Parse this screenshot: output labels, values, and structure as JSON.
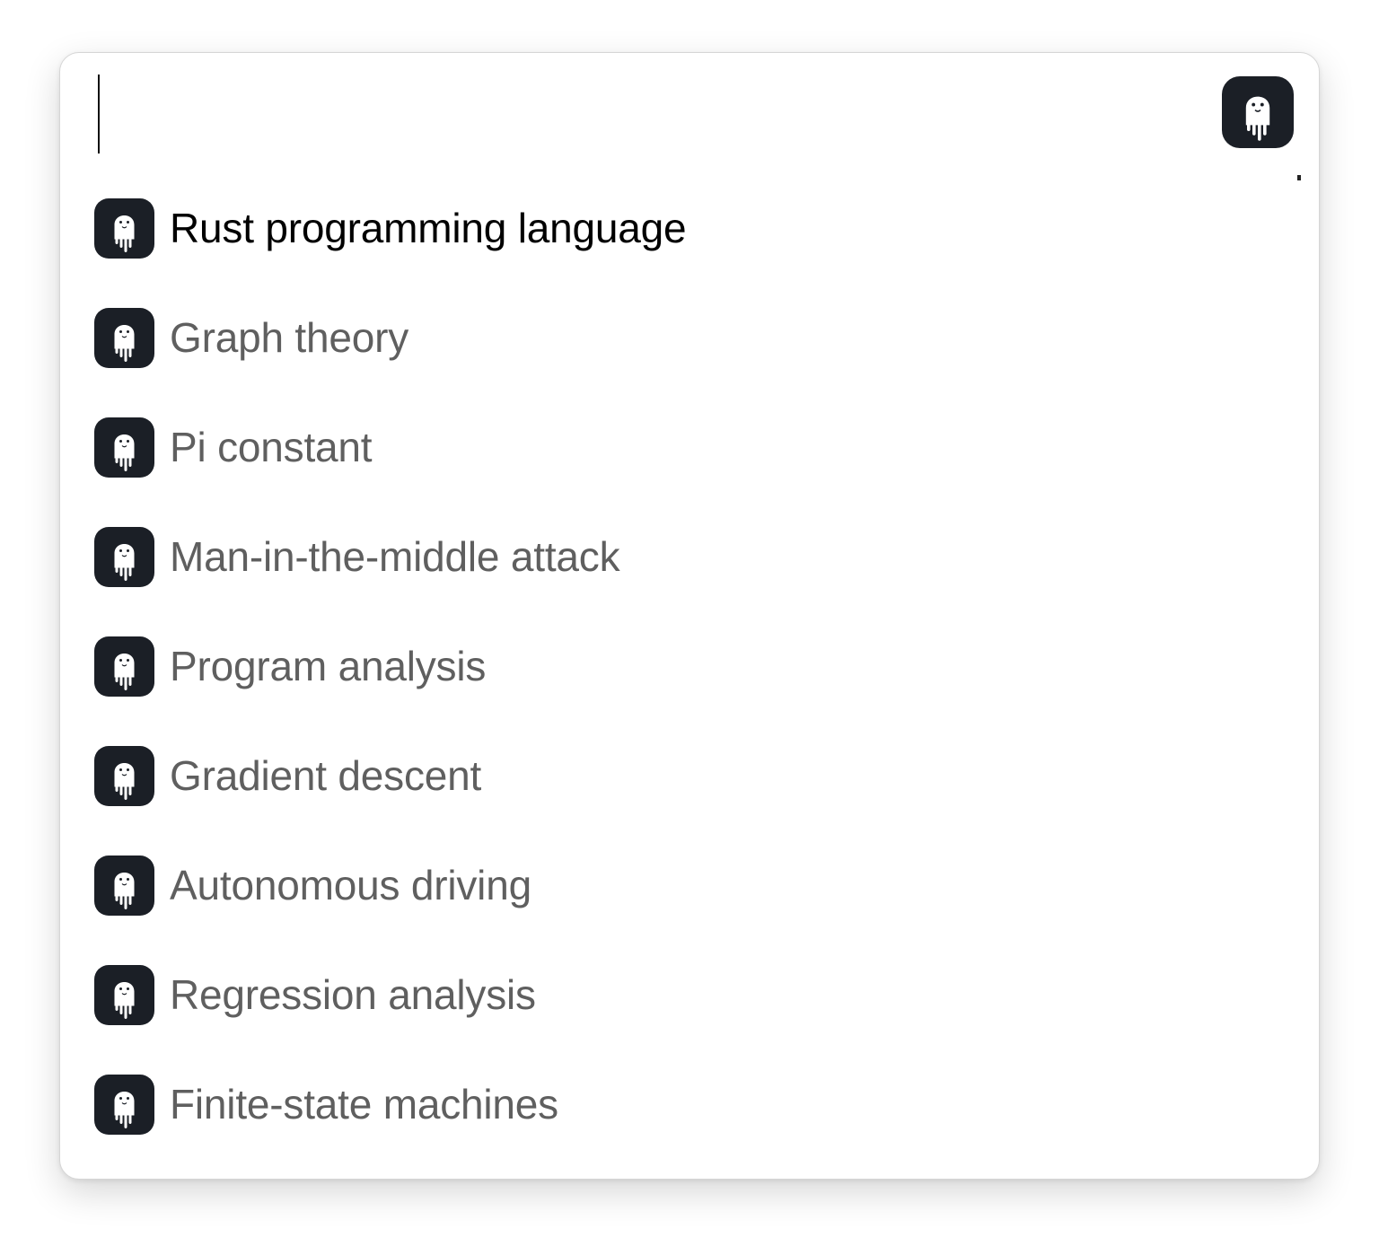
{
  "search": {
    "value": "",
    "placeholder": ""
  },
  "app": {
    "icon": "ghost-app-icon"
  },
  "colors": {
    "icon_bg": "#1b1f26",
    "icon_fg": "#ffffff",
    "selected_text": "#000000",
    "text": "#5f5f5f"
  },
  "results": [
    {
      "label": "Rust programming language",
      "icon": "ghost-icon",
      "selected": true
    },
    {
      "label": "Graph theory",
      "icon": "ghost-icon"
    },
    {
      "label": "Pi constant",
      "icon": "ghost-icon"
    },
    {
      "label": "Man-in-the-middle attack",
      "icon": "ghost-icon"
    },
    {
      "label": "Program analysis",
      "icon": "ghost-icon"
    },
    {
      "label": "Gradient descent",
      "icon": "ghost-icon"
    },
    {
      "label": "Autonomous driving",
      "icon": "ghost-icon"
    },
    {
      "label": "Regression analysis",
      "icon": "ghost-icon"
    },
    {
      "label": "Finite-state machines",
      "icon": "ghost-icon"
    }
  ]
}
